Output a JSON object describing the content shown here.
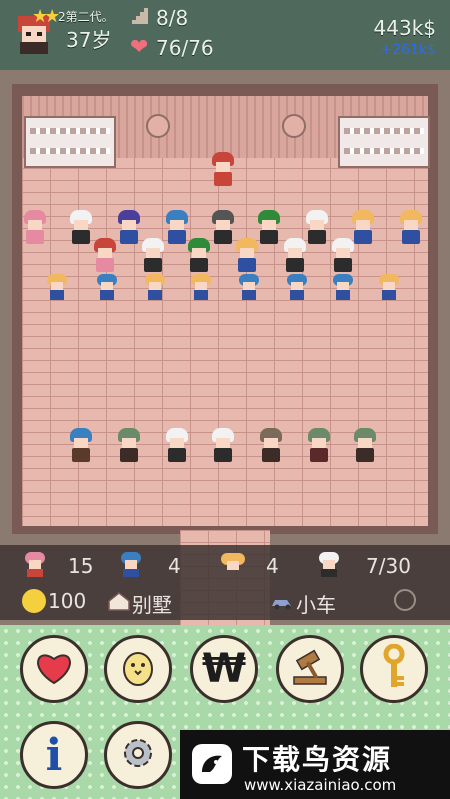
{
  "hud": {
    "generation": "2第二代。",
    "age": "37岁",
    "house_count": "8/8",
    "health": "76/76",
    "money": "443k$",
    "income": "+261k$"
  },
  "panel": {
    "counts": [
      "15",
      "4",
      "4",
      "7/30"
    ],
    "happiness": "100",
    "residence_label": "别墅",
    "vehicle_label": "小车"
  },
  "buttons": [
    {
      "name": "heart"
    },
    {
      "name": "chick"
    },
    {
      "name": "won"
    },
    {
      "name": "gavel"
    },
    {
      "name": "key"
    },
    {
      "name": "info"
    },
    {
      "name": "settings"
    }
  ],
  "watermark": {
    "title": "下载鸟资源",
    "url": "www.xiazainiao.com"
  },
  "colors": {
    "hud_bg": "#4f6a5c",
    "floor": "#e6b8ae",
    "panel_bg": "#413734",
    "button_bg": "#f6efd9",
    "heart": "#e53b4a"
  }
}
